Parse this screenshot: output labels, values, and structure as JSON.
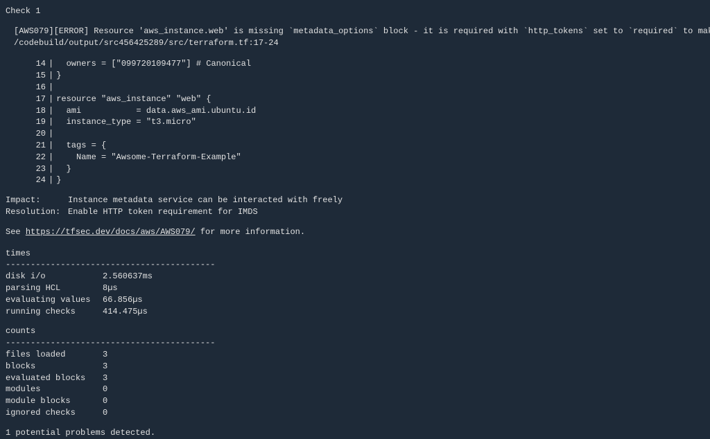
{
  "header": "Check 1",
  "error": {
    "code": "[AWS079]",
    "level": "[ERROR]",
    "message": "Resource 'aws_instance.web' is missing `metadata_options` block - it is required with `http_tokens` set to `required` to make Instance Metadata Service more secure.",
    "filepath": "/codebuild/output/src456425289/src/terraform.tf:17-24"
  },
  "code": {
    "lines": [
      {
        "ln": "14",
        "text": "  owners = [\"099720109477\"] # Canonical"
      },
      {
        "ln": "15",
        "text": "}"
      },
      {
        "ln": "16",
        "text": ""
      },
      {
        "ln": "17",
        "text": "resource \"aws_instance\" \"web\" {"
      },
      {
        "ln": "18",
        "text": "  ami           = data.aws_ami.ubuntu.id"
      },
      {
        "ln": "19",
        "text": "  instance_type = \"t3.micro\""
      },
      {
        "ln": "20",
        "text": ""
      },
      {
        "ln": "21",
        "text": "  tags = {"
      },
      {
        "ln": "22",
        "text": "    Name = \"Awsome-Terraform-Example\""
      },
      {
        "ln": "23",
        "text": "  }"
      },
      {
        "ln": "24",
        "text": "}"
      }
    ]
  },
  "impact": {
    "label": "Impact:",
    "text": "Instance metadata service can be interacted with freely"
  },
  "resolution": {
    "label": "Resolution:",
    "text": "Enable HTTP token requirement for IMDS"
  },
  "see": {
    "prefix": "See ",
    "url": "https://tfsec.dev/docs/aws/AWS079/",
    "suffix": " for more information."
  },
  "times": {
    "title": "times",
    "dashes": "------------------------------------------",
    "rows": [
      {
        "label": "disk i/o",
        "value": "2.560637ms"
      },
      {
        "label": "parsing HCL",
        "value": "8µs"
      },
      {
        "label": "evaluating values",
        "value": "66.856µs"
      },
      {
        "label": "running checks",
        "value": "414.475µs"
      }
    ]
  },
  "counts": {
    "title": "counts",
    "dashes": "------------------------------------------",
    "rows": [
      {
        "label": "files loaded",
        "value": "3"
      },
      {
        "label": "blocks",
        "value": "3"
      },
      {
        "label": "evaluated blocks",
        "value": "3"
      },
      {
        "label": "modules",
        "value": "0"
      },
      {
        "label": "module blocks",
        "value": "0"
      },
      {
        "label": "ignored checks",
        "value": "0"
      }
    ]
  },
  "footer": "1 potential problems detected."
}
